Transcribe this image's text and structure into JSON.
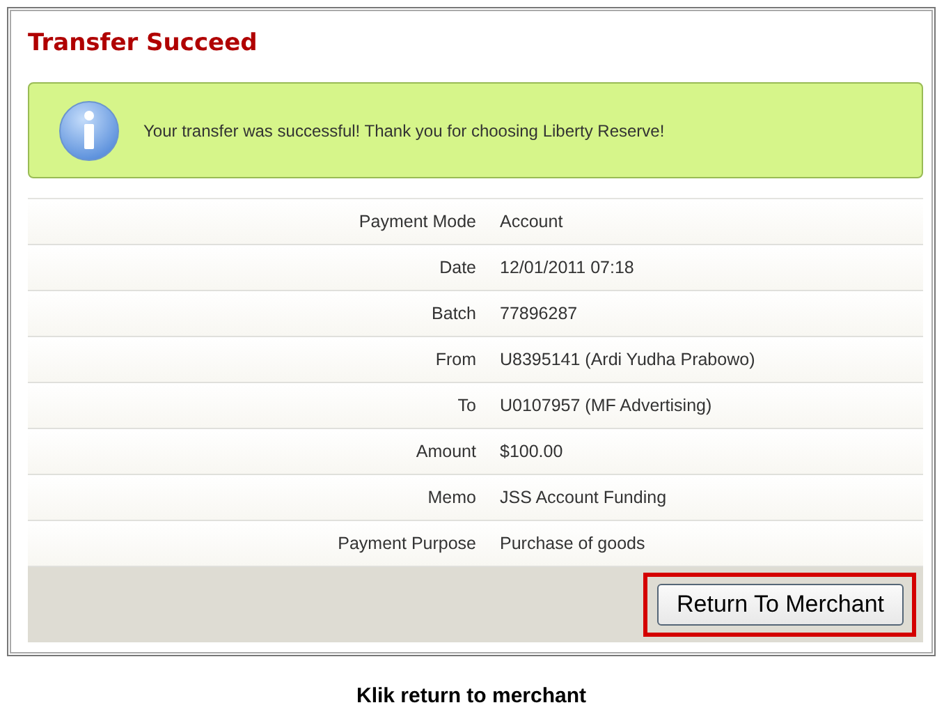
{
  "title": "Transfer Succeed",
  "alert": {
    "message": "Your transfer was successful! Thank you for choosing Liberty Reserve!"
  },
  "details": [
    {
      "label": "Payment Mode",
      "value": "Account"
    },
    {
      "label": "Date",
      "value": "12/01/2011 07:18"
    },
    {
      "label": "Batch",
      "value": "77896287"
    },
    {
      "label": "From",
      "value": "U8395141 (Ardi Yudha Prabowo)"
    },
    {
      "label": "To",
      "value": "U0107957 (MF Advertising)"
    },
    {
      "label": "Amount",
      "value": "$100.00"
    },
    {
      "label": "Memo",
      "value": "JSS Account Funding"
    },
    {
      "label": "Payment Purpose",
      "value": "Purchase of goods"
    }
  ],
  "button": {
    "label": "Return To Merchant",
    "highlighted": true
  },
  "caption": "Klik return to merchant"
}
